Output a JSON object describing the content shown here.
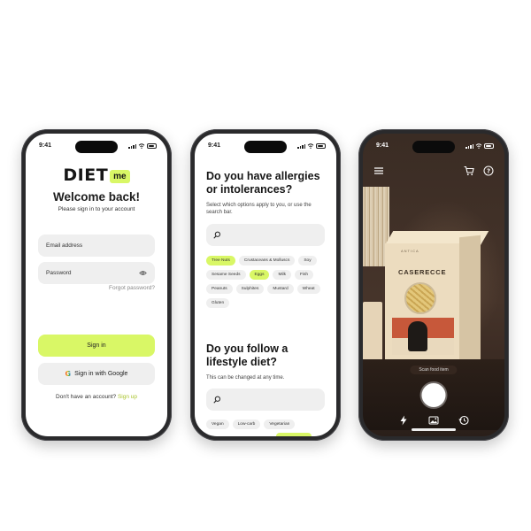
{
  "phones": {
    "login": {
      "status_time": "9:41",
      "logo_word": "DIET",
      "logo_badge": "me",
      "title": "Welcome back!",
      "subtitle": "Please sign in to your account",
      "email_placeholder": "Email address",
      "password_placeholder": "Password",
      "forgot_label": "Forgot password?",
      "signin_label": "Sign in",
      "google_label": "Sign in with Google",
      "no_account_text": "Don't have an account?",
      "signup_label": "Sign up"
    },
    "allergies": {
      "status_time": "9:41",
      "q1_line1": "Do you have allergies",
      "q1_line2": "or intolerances?",
      "q1_sub": "Select which options apply to you, or use the search bar.",
      "allergy_chips": [
        {
          "label": "Tree Nuts",
          "selected": true
        },
        {
          "label": "Crustaceans & Molluscs",
          "selected": false
        },
        {
          "label": "Soy",
          "selected": false
        },
        {
          "label": "Sesame Seeds",
          "selected": false
        },
        {
          "label": "Eggs",
          "selected": true
        },
        {
          "label": "Milk",
          "selected": false
        },
        {
          "label": "Fish",
          "selected": false
        },
        {
          "label": "Peanuts",
          "selected": false
        },
        {
          "label": "Sulphites",
          "selected": false
        },
        {
          "label": "Mustard",
          "selected": false
        },
        {
          "label": "Wheat",
          "selected": false
        },
        {
          "label": "Gluten",
          "selected": false
        }
      ],
      "q2_line1": "Do you follow a",
      "q2_line2": "lifestyle diet?",
      "q2_sub": "This can be changed at any time.",
      "diet_chips": [
        {
          "label": "Vegan",
          "selected": false
        },
        {
          "label": "Low-carb",
          "selected": false
        },
        {
          "label": "Vegetarian",
          "selected": false
        }
      ]
    },
    "scanner": {
      "status_time": "9:41",
      "box_brand": "ANTICA",
      "box_product": "CASERECCE",
      "scan_hint": "Scan food item"
    }
  },
  "colors": {
    "accent": "#d9f766",
    "link": "#aac42e",
    "field_bg": "#efefef",
    "phone_frame": "#2a2a2c"
  },
  "icons": [
    "search-icon",
    "eye-icon",
    "google-icon",
    "menu-icon",
    "cart-icon",
    "help-icon",
    "flash-icon",
    "gallery-icon",
    "history-icon"
  ]
}
